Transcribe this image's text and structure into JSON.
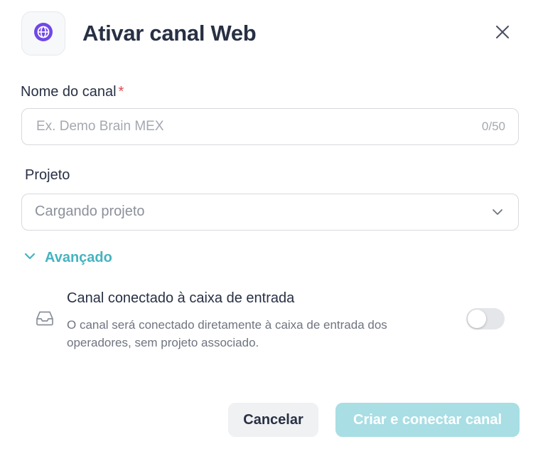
{
  "dialog": {
    "title": "Ativar canal Web",
    "icon": "globe-icon",
    "accent_color": "#7048e8"
  },
  "channel_name": {
    "label": "Nome do canal",
    "required_mark": "*",
    "placeholder": "Ex. Demo Brain MEX",
    "value": "",
    "counter": "0/50"
  },
  "project": {
    "label": "Projeto",
    "selected": "Cargando projeto"
  },
  "advanced": {
    "label": "Avançado",
    "color": "#45b3bf",
    "option": {
      "title": "Canal conectado à caixa de entrada",
      "description": "O canal será conectado diretamente à caixa de entrada dos operadores, sem projeto associado.",
      "enabled": false
    }
  },
  "actions": {
    "cancel_label": "Cancelar",
    "create_label": "Criar e conectar canal"
  }
}
